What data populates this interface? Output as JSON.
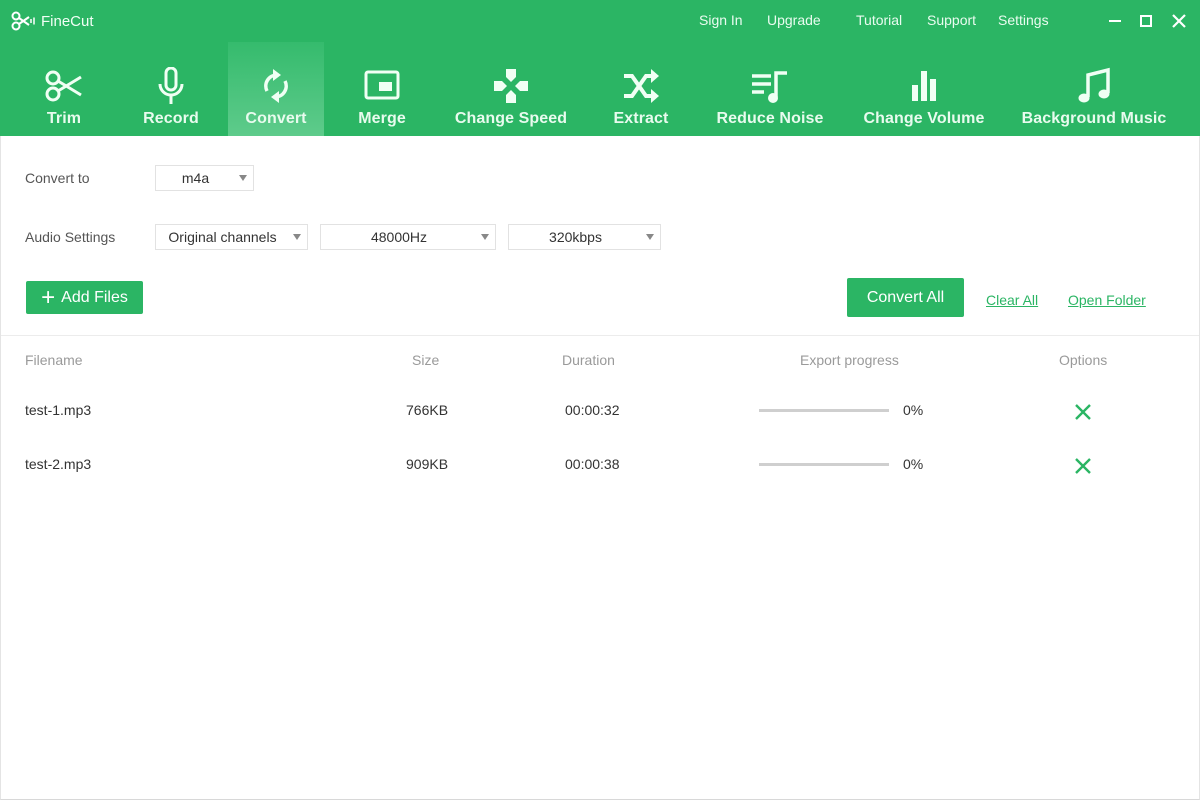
{
  "app": {
    "name": "FineCut",
    "accent_color": "#2bb564"
  },
  "topnav": {
    "links": [
      "Sign In",
      "Upgrade",
      "Tutorial",
      "Support",
      "Settings"
    ]
  },
  "window_controls": [
    "minimize-icon",
    "maximize-icon",
    "close-icon"
  ],
  "toolbar": {
    "active": "Convert",
    "tools": [
      {
        "label": "Trim",
        "icon": "scissors-icon"
      },
      {
        "label": "Record",
        "icon": "microphone-icon"
      },
      {
        "label": "Convert",
        "icon": "convert-arrows-icon"
      },
      {
        "label": "Merge",
        "icon": "merge-window-icon"
      },
      {
        "label": "Change Speed",
        "icon": "dpad-icon"
      },
      {
        "label": "Extract",
        "icon": "shuffle-icon"
      },
      {
        "label": "Reduce Noise",
        "icon": "playlist-music-icon"
      },
      {
        "label": "Change Volume",
        "icon": "bar-chart-icon"
      },
      {
        "label": "Background Music",
        "icon": "music-note-icon"
      }
    ]
  },
  "settings": {
    "convert_to_label": "Convert to",
    "convert_to_value": "m4a",
    "audio_settings_label": "Audio Settings",
    "channels_value": "Original channels",
    "sample_rate_value": "48000Hz",
    "bitrate_value": "320kbps"
  },
  "actions": {
    "add_files": "Add Files",
    "convert_all": "Convert All",
    "clear_all": "Clear All",
    "open_folder": "Open Folder"
  },
  "table": {
    "columns": [
      "Filename",
      "Size",
      "Duration",
      "Export progress",
      "Options"
    ],
    "rows": [
      {
        "filename": "test-1.mp3",
        "size": "766KB",
        "duration": "00:00:32",
        "progress": 0,
        "progress_text": "0%"
      },
      {
        "filename": "test-2.mp3",
        "size": "909KB",
        "duration": "00:00:38",
        "progress": 0,
        "progress_text": "0%"
      }
    ]
  }
}
